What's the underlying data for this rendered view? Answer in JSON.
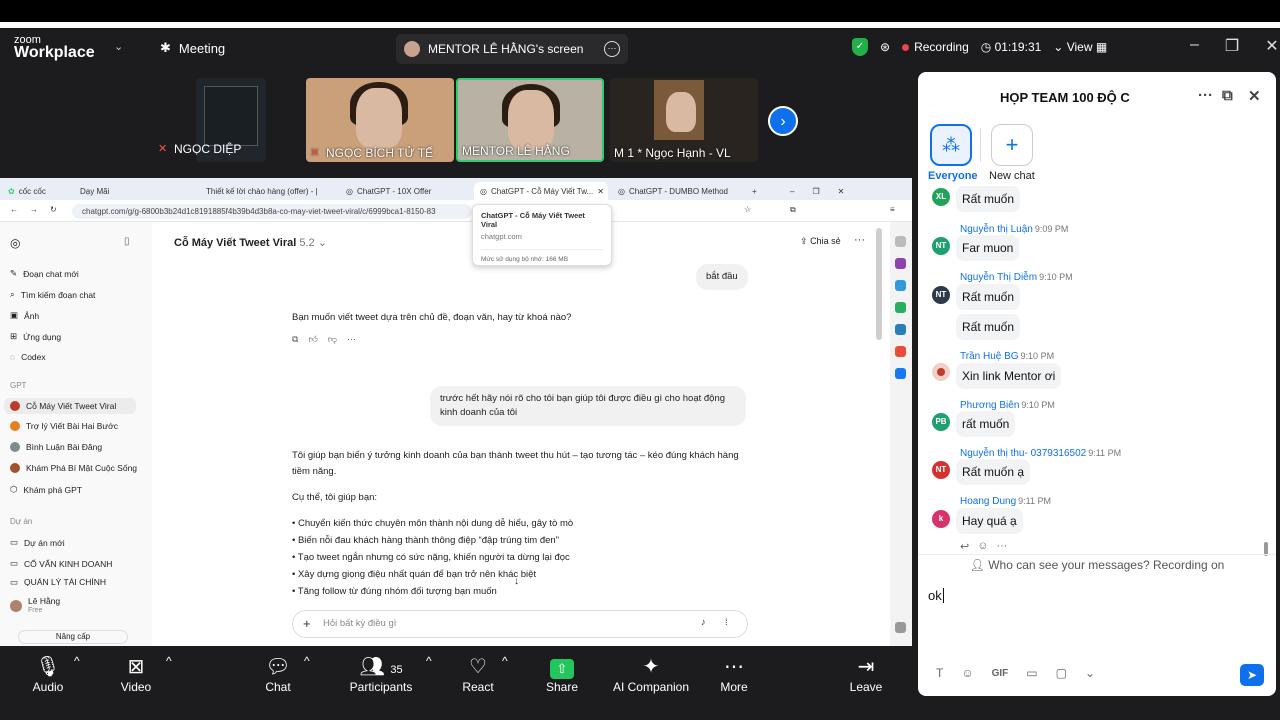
{
  "app": {
    "logo_top": "zoom",
    "logo_bottom": "Workplace"
  },
  "titlebar": {
    "meeting_label": "Meeting",
    "share_title": "MENTOR LÊ HẰNG's screen",
    "recording": "Recording",
    "timer": "01:19:31",
    "view": "View"
  },
  "videos": [
    {
      "name": "NGỌC DIỆP"
    },
    {
      "name": "NGỌC BÍCH TỬ TẾ"
    },
    {
      "name": "MENTOR LÊ HẰNG"
    },
    {
      "name": "M 1 * Ngọc Hạnh - VL"
    }
  ],
  "browser": {
    "tabs": [
      "cốc cốc",
      "Dạy Mãi",
      "Thiết kế lời chào hàng (offer) - |",
      "ChatGPT - 10X Offer",
      "ChatGPT - Cỗ Máy Viết Tw...",
      "ChatGPT - DUMBO Method"
    ],
    "url": "chatgpt.com/g/g-6800b3b24d1c8191885f4b39b4d3b8a-co-may-viet-tweet-viral/c/6999bca1-8150-83",
    "tooltip": {
      "title": "ChatGPT - Cỗ Máy Viết Tweet Viral",
      "domain": "chatgpt.com",
      "memory": "Mức sử dụng bộ nhớ: 166 MB"
    }
  },
  "gpt_sidebar": {
    "items": [
      "Đoạn chat mới",
      "Tìm kiếm đoạn chat",
      "Ảnh",
      "Ứng dụng",
      "Codex"
    ],
    "gpt_section": "GPT",
    "gpts": [
      "Cỗ Máy Viết Tweet Viral",
      "Trợ lý Viết Bài Hai Bước",
      "Bình Luận Bài Đăng",
      "Khám Phá Bí Mật Cuộc Sống",
      "Khám phá GPT"
    ],
    "project_section": "Dự án",
    "projects": [
      "Dự án mới",
      "CỐ VẤN KINH DOANH",
      "QUẢN LÝ TÀI CHÍNH"
    ],
    "user_name": "Lê Hằng",
    "user_plan": "Free",
    "upgrade": "Nâng cấp"
  },
  "gpt_main": {
    "title": "Cỗ Máy Viết Tweet Viral",
    "model": "5.2",
    "share": "Chia sẻ",
    "user_msg_1": "bắt đầu",
    "assistant_msg_1": "Bạn muốn viết tweet dựa trên chủ đề, đoạn văn, hay từ khoá nào?",
    "user_msg_2": "trước hết hãy nói rõ cho tôi bạn giúp tôi được điều gì cho hoạt động kinh doanh của tôi",
    "assistant_msg_2a": "Tôi giúp bạn biến ý tưởng kinh doanh của bạn thành tweet thu hút – tạo tương tác – kéo đúng khách hàng tiềm năng.",
    "assistant_msg_2b": "Cụ thể, tôi giúp bạn:",
    "bullets": [
      "• Chuyển kiến thức chuyên môn thành nội dung dễ hiểu, gây tò mò",
      "• Biến nỗi đau khách hàng thành thông điệp “đập trúng tim đen”",
      "• Tạo tweet ngắn nhưng có sức nặng, khiến người ta dừng lại đọc",
      "• Xây dựng giọng điệu nhất quán để bạn trở nên khác biệt",
      "• Tăng follow từ đúng nhóm đối tượng bạn muốn"
    ],
    "composer_placeholder": "Hỏi bất kỳ điều gì"
  },
  "chat": {
    "title": "HỌP TEAM 100 ĐỘ C",
    "everyone": "Everyone",
    "new_chat": "New chat",
    "messages": [
      {
        "sender": "",
        "time": "",
        "text": "Rất muốn",
        "initials": "XL",
        "color": "#22a35a"
      },
      {
        "sender": "Nguyễn thị Luận",
        "time": "9:09 PM",
        "text": "Far muon",
        "initials": "NT",
        "color": "#1f9e6e"
      },
      {
        "sender": "Nguyễn Thị Diễm",
        "time": "9:10 PM",
        "text": "Rất muốn",
        "initials": "NT",
        "color": "#2d3a4a"
      },
      {
        "sender": "",
        "time": "",
        "text": "Rất muốn",
        "initials": "",
        "color": ""
      },
      {
        "sender": "Trần Huệ BG",
        "time": "9:10 PM",
        "text": "Xin link Mentor ơi",
        "initials": "",
        "color": "#c0392b"
      },
      {
        "sender": "Phương Biên",
        "time": "9:10 PM",
        "text": "rất muốn",
        "initials": "PB",
        "color": "#1f9e6e"
      },
      {
        "sender": "Nguyễn thị thu- 0379316502",
        "time": "9:11 PM",
        "text": "Rất muốn ạ",
        "initials": "NT",
        "color": "#d63031"
      },
      {
        "sender": "Hoang Dung",
        "time": "9:11 PM",
        "text": "Hay quá ạ",
        "initials": "k",
        "color": "#d6336c"
      }
    ],
    "who_can_see": "Who can see your messages? Recording on",
    "input_value": "ok",
    "tools": [
      "T",
      "☺",
      "GIF",
      "▭",
      "▢",
      "⌄"
    ]
  },
  "toolbar": {
    "audio": "Audio",
    "video": "Video",
    "chat": "Chat",
    "participants": "Participants",
    "participants_count": "35",
    "react": "React",
    "share": "Share",
    "ai": "AI Companion",
    "more": "More",
    "leave": "Leave"
  }
}
